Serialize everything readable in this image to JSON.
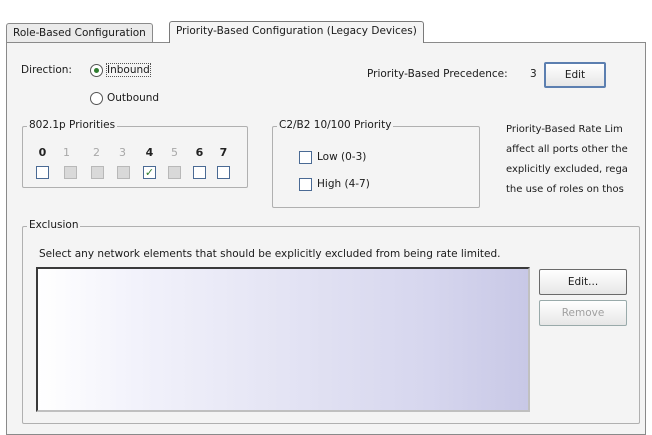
{
  "tabs": [
    {
      "label": "Role-Based Configuration",
      "active": false
    },
    {
      "label": "Priority-Based Configuration (Legacy Devices)",
      "active": true
    }
  ],
  "direction": {
    "label": "Direction:",
    "options": [
      {
        "label": "Inbound",
        "selected": true
      },
      {
        "label": "Outbound",
        "selected": false
      }
    ]
  },
  "precedence": {
    "label": "Priority-Based Precedence:",
    "value": "3",
    "edit_label": "Edit"
  },
  "priorities_8021p": {
    "title": "802.1p Priorities",
    "items": [
      {
        "label": "0",
        "enabled": true,
        "checked": false
      },
      {
        "label": "1",
        "enabled": false,
        "checked": false
      },
      {
        "label": "2",
        "enabled": false,
        "checked": false
      },
      {
        "label": "3",
        "enabled": false,
        "checked": false
      },
      {
        "label": "4",
        "enabled": true,
        "checked": true
      },
      {
        "label": "5",
        "enabled": false,
        "checked": false
      },
      {
        "label": "6",
        "enabled": true,
        "checked": false
      },
      {
        "label": "7",
        "enabled": true,
        "checked": false
      }
    ]
  },
  "c2b2": {
    "title": "C2/B2 10/100 Priority",
    "low_label": "Low (0-3)",
    "high_label": "High (4-7)"
  },
  "info_lines": [
    "Priority-Based Rate Lim",
    "affect all ports other the",
    "explicitly excluded, rega",
    "the use of roles on thos"
  ],
  "exclusion": {
    "title": "Exclusion",
    "description": "Select any network elements that should be explicitly excluded from being rate limited.",
    "edit_label": "Edit...",
    "remove_label": "Remove"
  },
  "colors": {
    "panel_bg": "#f4f4f4",
    "check_green": "#2f7d2f",
    "focus_border": "#5c7fb0"
  }
}
